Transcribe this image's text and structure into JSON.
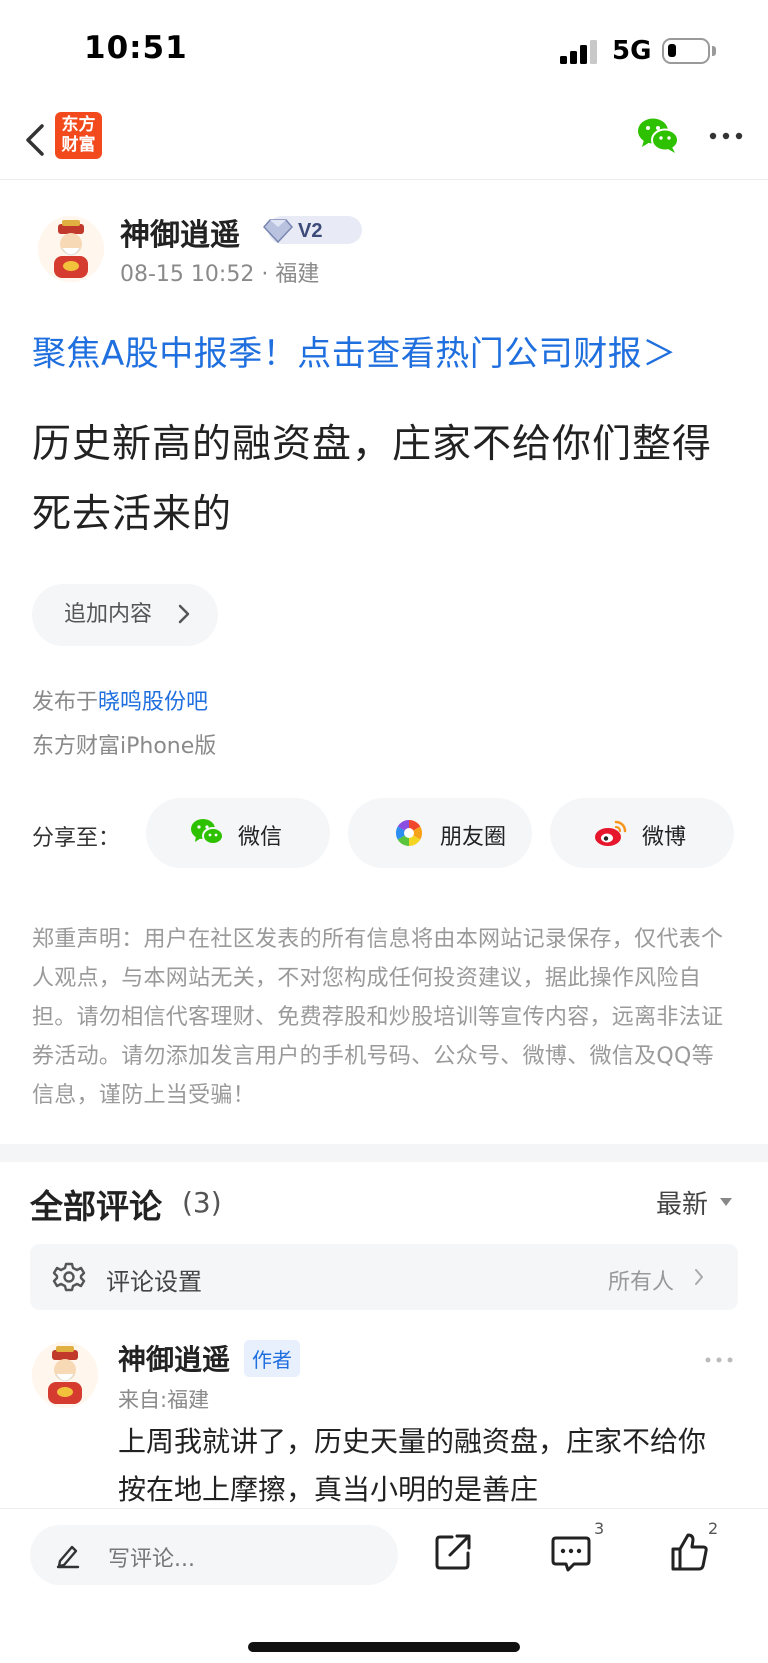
{
  "status_bar": {
    "time": "10:51",
    "network": "5G"
  },
  "nav": {
    "logo_text_line1": "东方",
    "logo_text_line2": "财富"
  },
  "post": {
    "author": {
      "name": "神御逍遥",
      "level": "V2",
      "date": "08-15 10:52",
      "location": "福建",
      "meta_sep": "·"
    },
    "promo_link": "聚焦A股中报季！点击查看热门公司财报＞",
    "title": "历史新高的融资盘，庄家不给你们整得死去活来的",
    "add_content_label": "追加内容",
    "published_prefix": "发布于",
    "published_forum": "晓鸣股份吧",
    "device": "东方财富iPhone版"
  },
  "share": {
    "label": "分享至：",
    "wechat": "微信",
    "moments": "朋友圈",
    "weibo": "微博"
  },
  "disclaimer": "郑重声明：用户在社区发表的所有信息将由本网站记录保存，仅代表个人观点，与本网站无关，不对您构成任何投资建议，据此操作风险自担。请勿相信代客理财、免费荐股和炒股培训等宣传内容，远离非法证券活动。请勿添加发言用户的手机号码、公众号、微博、微信及QQ等信息，谨防上当受骗！",
  "comments": {
    "heading": "全部评论",
    "count": "(3)",
    "sort": "最新",
    "settings_label": "评论设置",
    "settings_value": "所有人",
    "items": [
      {
        "name": "神御逍遥",
        "tag": "作者",
        "from": "来自:福建",
        "text": "上周我就讲了，历史天量的融资盘，庄家不给你按在地上摩擦，真当小明的是善庄"
      }
    ]
  },
  "bottom_bar": {
    "compose_placeholder": "写评论...",
    "comment_count": "3",
    "like_count": "2"
  },
  "colors": {
    "accent": "#1f6fdf",
    "brand": "#f24a1d",
    "wechat_green": "#2dc100"
  }
}
